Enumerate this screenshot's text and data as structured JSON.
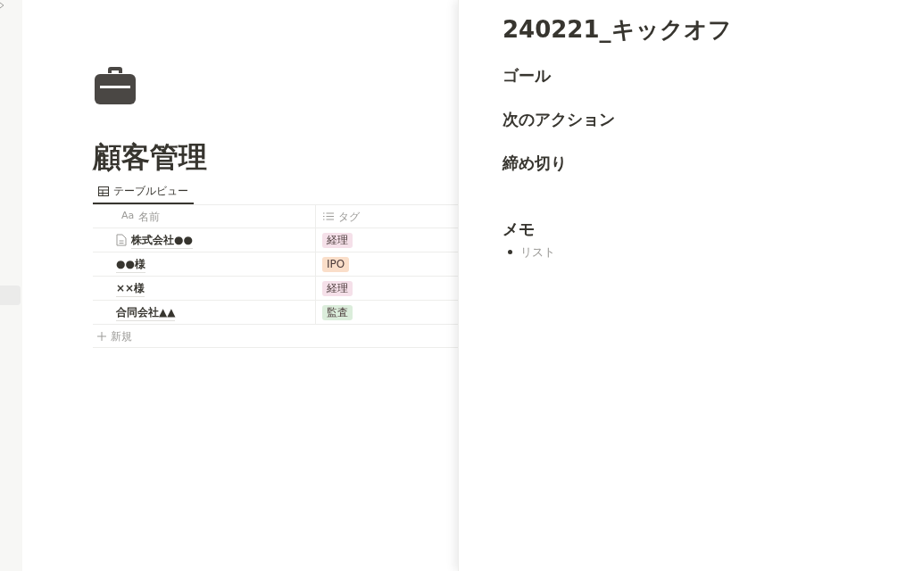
{
  "page": {
    "title": "顧客管理",
    "views": [
      {
        "label": "テーブルビュー",
        "selected": true
      }
    ],
    "table": {
      "columns": [
        "名前",
        "タグ"
      ],
      "title_type_glyph": "Aa",
      "rows": [
        {
          "name": "株式会社●●",
          "has_page_icon": true,
          "tag": {
            "label": "経理",
            "color": "#f5e0e9"
          }
        },
        {
          "name": "●●様",
          "has_page_icon": false,
          "tag": {
            "label": "IPO",
            "color": "#fadec9"
          }
        },
        {
          "name": "××様",
          "has_page_icon": false,
          "tag": {
            "label": "経理",
            "color": "#f5e0e9"
          }
        },
        {
          "name": "合同会社▲▲",
          "has_page_icon": false,
          "tag": {
            "label": "監査",
            "color": "#dbeddb"
          }
        }
      ],
      "new_row": "新規"
    }
  },
  "peek": {
    "title": "240221_キックオフ",
    "headings": [
      "ゴール",
      "次のアクション",
      "締め切り"
    ],
    "memo_heading": "メモ",
    "bullets": [
      "リスト"
    ]
  }
}
